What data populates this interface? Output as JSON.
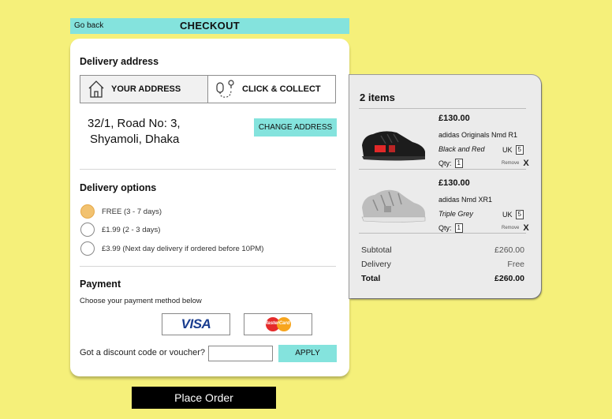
{
  "header": {
    "back_label": "Go back",
    "title": "CHECKOUT"
  },
  "delivery_address": {
    "heading": "Delivery address",
    "tabs": [
      {
        "label": "YOUR ADDRESS",
        "icon": "house-icon",
        "active": true
      },
      {
        "label": "CLICK & COLLECT",
        "icon": "map-pin-icon",
        "active": false
      }
    ],
    "address_line1": "32/1, Road No: 3,",
    "address_line2": "Shyamoli, Dhaka",
    "change_label": "CHANGE ADDRESS"
  },
  "delivery_options": {
    "heading": "Delivery options",
    "options": [
      {
        "label": "FREE (3 - 7 days)",
        "selected": true
      },
      {
        "label": "£1.99 (2 - 3 days)",
        "selected": false
      },
      {
        "label": "£3.99 (Next day delivery if ordered before 10PM)",
        "selected": false
      }
    ]
  },
  "payment": {
    "heading": "Payment",
    "subheading": "Choose your payment method below",
    "methods": [
      {
        "label": "VISA"
      },
      {
        "label": "MasterCard"
      }
    ],
    "discount_label": "Got a discount code or voucher?",
    "discount_value": "",
    "apply_label": "APPLY"
  },
  "place_order_label": "Place Order",
  "summary": {
    "title": "2 items",
    "items": [
      {
        "price": "£130.00",
        "name": "adidas Originals Nmd R1",
        "color": "Black and Red",
        "size_label": "UK",
        "size": "5",
        "qty_label": "Qty:",
        "qty": "1",
        "remove_label": "Remove",
        "remove_x": "X"
      },
      {
        "price": "£130.00",
        "name": "adidas Nmd XR1",
        "color": "Triple Grey",
        "size_label": "UK",
        "size": "5",
        "qty_label": "Qty:",
        "qty": "1",
        "remove_label": "Remove",
        "remove_x": "X"
      }
    ],
    "subtotal_label": "Subtotal",
    "subtotal_value": "£260.00",
    "delivery_label": "Delivery",
    "delivery_value": "Free",
    "total_label": "Total",
    "total_value": "£260.00"
  },
  "colors": {
    "background": "#f5f07a",
    "accent": "#84e3dd",
    "radio_selected": "#f2c270",
    "button_dark": "#000000"
  }
}
